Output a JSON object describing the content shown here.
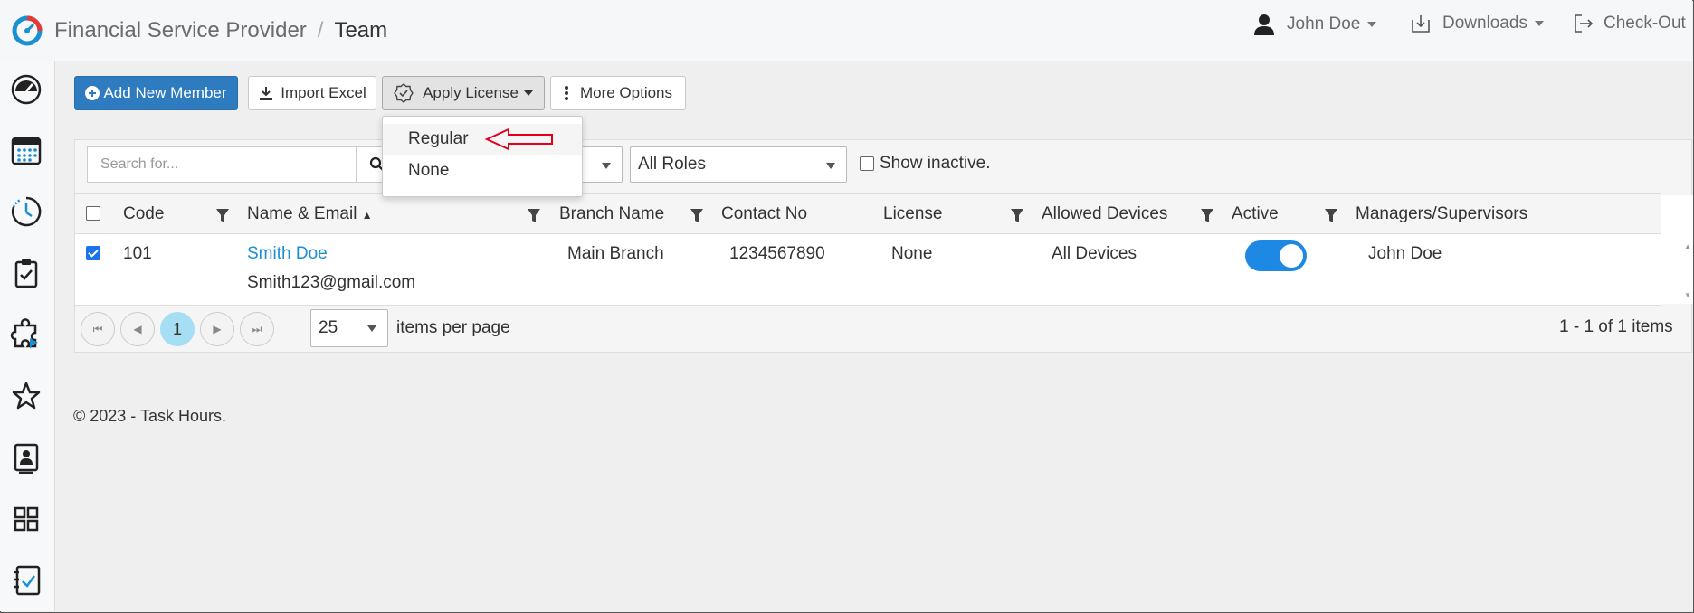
{
  "header": {
    "breadcrumb": [
      "Financial Service Provider",
      "Team"
    ],
    "user": "John Doe",
    "downloads": "Downloads",
    "checkout": "Check-Out"
  },
  "sidebar": {
    "items": [
      "dashboard-gauge-icon",
      "calendar-icon",
      "clock-icon",
      "clipboard-check-icon",
      "puzzle-icon",
      "star-icon",
      "contact-card-icon",
      "grid-icon",
      "notebook-check-icon"
    ]
  },
  "toolbar": {
    "add_member": "Add New Member",
    "import_excel": "Import Excel",
    "apply_license": "Apply License",
    "more_options": "More Options"
  },
  "license_menu": {
    "options": [
      "Regular",
      "None"
    ]
  },
  "filters": {
    "search_placeholder": "Search for...",
    "roles": "All Roles",
    "show_inactive": "Show inactive."
  },
  "table": {
    "columns": [
      "Code",
      "Name & Email",
      "Branch Name",
      "Contact No",
      "License",
      "Allowed Devices",
      "Active",
      "Managers/Supervisors"
    ],
    "rows": [
      {
        "selected": true,
        "code": "101",
        "name": "Smith Doe",
        "email": "Smith123@gmail.com",
        "branch": "Main Branch",
        "contact": "1234567890",
        "license": "None",
        "devices": "All Devices",
        "active": true,
        "manager": "John Doe"
      }
    ]
  },
  "pager": {
    "current_page": "1",
    "page_size": "25",
    "items_per_page": "items per page",
    "summary": "1 - 1 of 1 items"
  },
  "footer": {
    "copyright": "© 2023 - Task Hours."
  },
  "colors": {
    "primary": "#2e7bbf",
    "toggle": "#1e88e5",
    "link": "#1a8fd1",
    "pager_current": "#a6dff3",
    "annotation_arrow": "#e0001b"
  }
}
